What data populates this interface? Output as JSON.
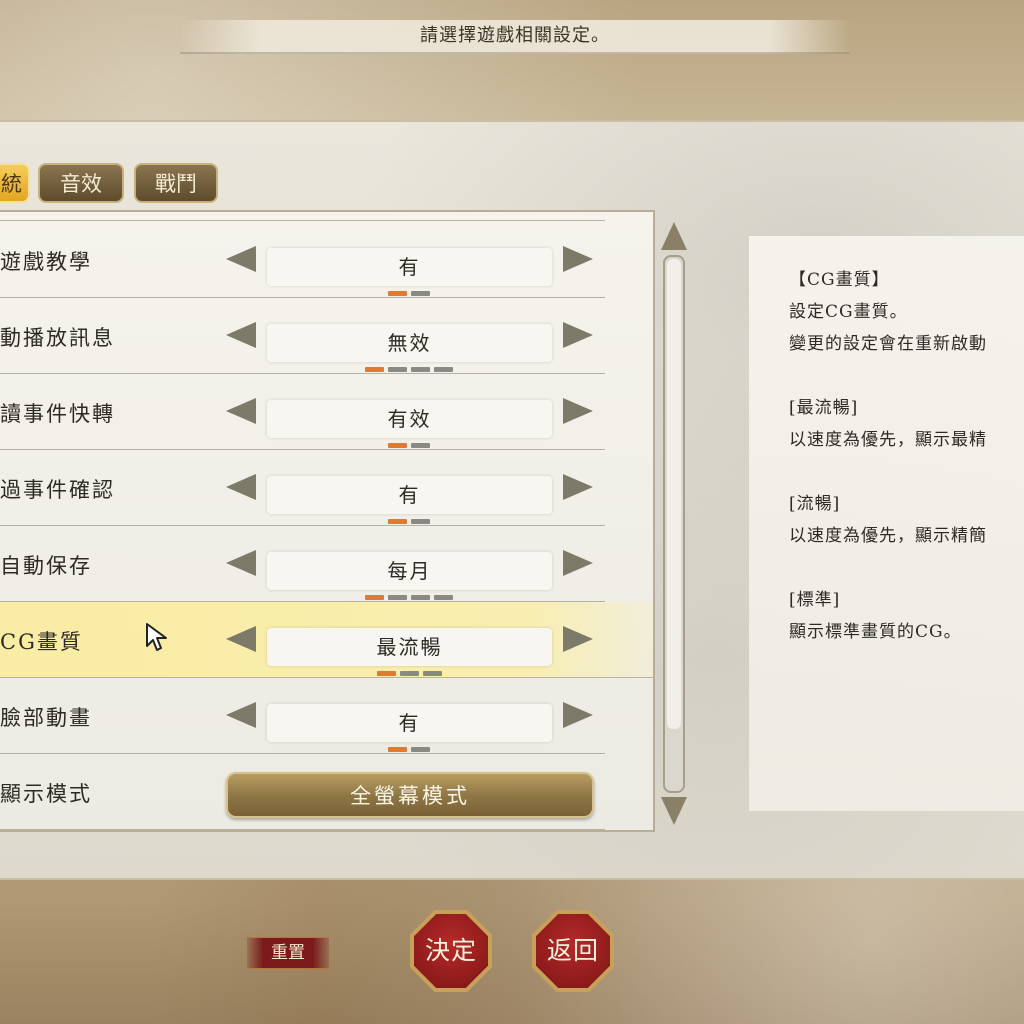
{
  "header": {
    "instruction": "請選擇遊戲相關設定。"
  },
  "tabs": [
    {
      "label": "統"
    },
    {
      "label": "音效"
    },
    {
      "label": "戰鬥"
    }
  ],
  "settings": [
    {
      "label": "遊戲教學",
      "value": "有",
      "option_count": 2,
      "selected_index": 0
    },
    {
      "label": "動播放訊息",
      "value": "無效",
      "option_count": 4,
      "selected_index": 0
    },
    {
      "label": "讀事件快轉",
      "value": "有效",
      "option_count": 2,
      "selected_index": 0
    },
    {
      "label": "過事件確認",
      "value": "有",
      "option_count": 2,
      "selected_index": 0
    },
    {
      "label": "自動保存",
      "value": "每月",
      "option_count": 4,
      "selected_index": 0
    },
    {
      "label": "CG畫質",
      "value": "最流暢",
      "option_count": 3,
      "selected_index": 0
    },
    {
      "label": "臉部動畫",
      "value": "有",
      "option_count": 2,
      "selected_index": 0
    },
    {
      "label": "顯示模式",
      "value": "全螢幕模式"
    }
  ],
  "description": {
    "lines": [
      "【CG畫質】",
      "設定CG畫質。",
      "變更的設定會在重新啟動",
      "",
      "[最流暢]",
      "以速度為優先，顯示最精",
      "",
      "[流暢]",
      "以速度為優先，顯示精簡",
      "",
      "[標準]",
      "顯示標準畫質的CG。"
    ]
  },
  "buttons": {
    "reset": "重置",
    "confirm": "決定",
    "back": "返回"
  },
  "colors": {
    "accent_gold": "#e2a522",
    "dot_active": "#e07a30",
    "button_red": "#7d1414"
  }
}
